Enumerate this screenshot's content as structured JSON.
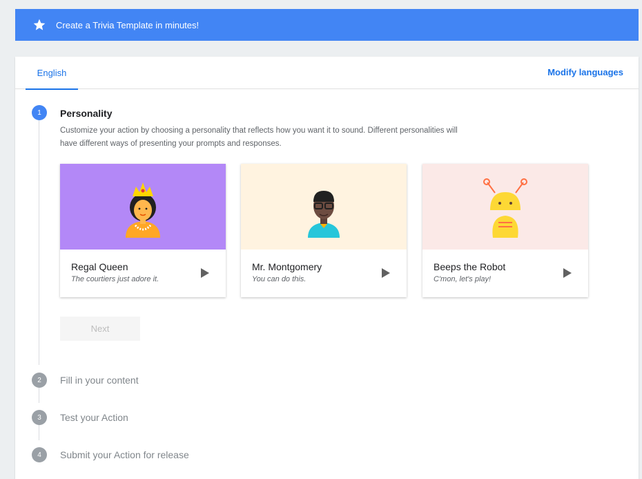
{
  "banner": {
    "title": "Create a Trivia Template in minutes!"
  },
  "tabs": {
    "english": "English",
    "modify_languages": "Modify languages"
  },
  "steps": [
    {
      "number": "1",
      "title": "Personality"
    },
    {
      "number": "2",
      "title": "Fill in your content"
    },
    {
      "number": "3",
      "title": "Test your Action"
    },
    {
      "number": "4",
      "title": "Submit your Action for release"
    }
  ],
  "personality": {
    "description": "Customize your action by choosing a personality that reflects how you want it to sound. Different personalities will have different ways of presenting your prompts and responses.",
    "cards": [
      {
        "name": "Regal Queen",
        "tagline": "The courtiers just adore it.",
        "color": "#b388f7"
      },
      {
        "name": "Mr. Montgomery",
        "tagline": "You can do this.",
        "color": "#fff3e0"
      },
      {
        "name": "Beeps the Robot",
        "tagline": "C'mon, let's play!",
        "color": "#fbe9e7"
      }
    ],
    "next_label": "Next"
  },
  "colors": {
    "accent": "#4285f4",
    "link": "#1a73e8"
  }
}
